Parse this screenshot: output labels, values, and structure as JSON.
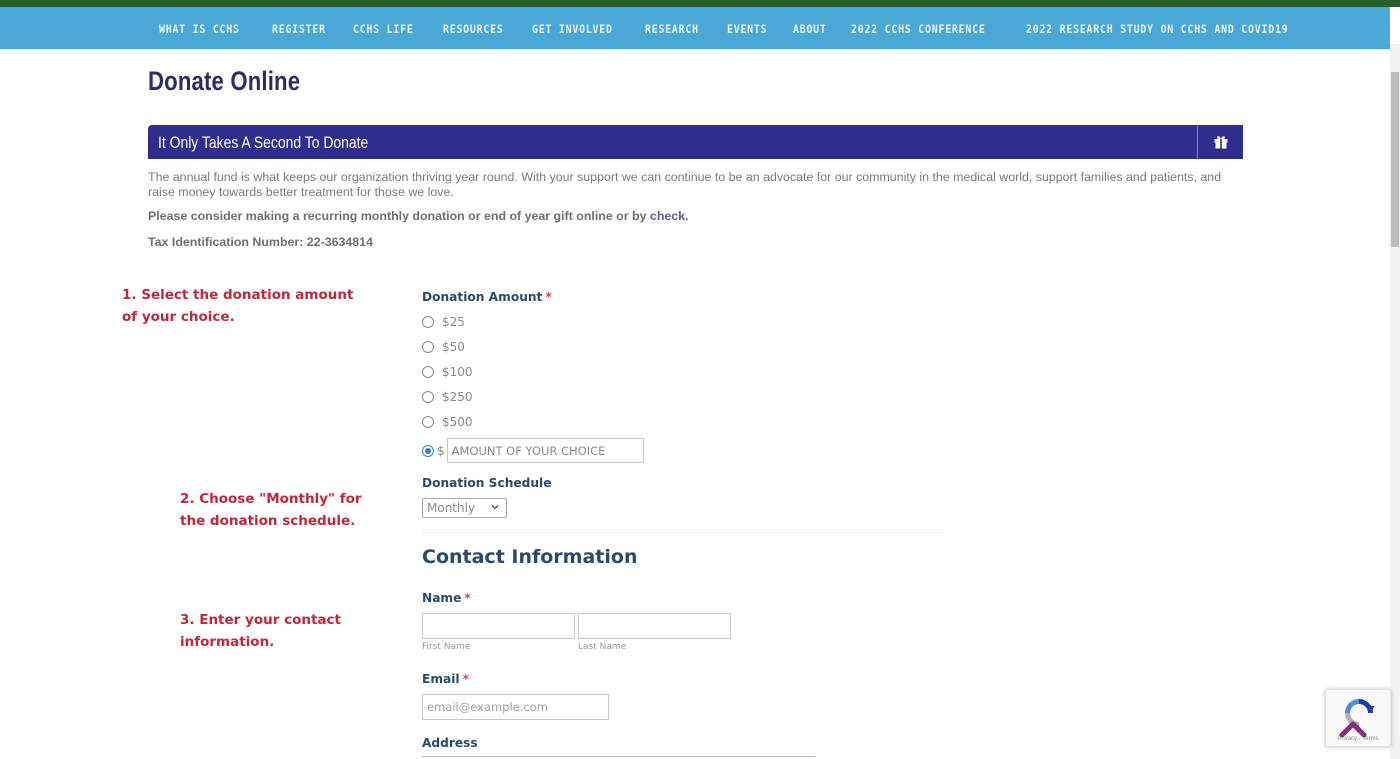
{
  "nav": {
    "items": [
      {
        "label": "WHAT IS CCHS"
      },
      {
        "label": "REGISTER"
      },
      {
        "label": "CCHS LIFE"
      },
      {
        "label": "RESOURCES"
      },
      {
        "label": "GET INVOLVED"
      },
      {
        "label": "RESEARCH"
      },
      {
        "label": "EVENTS"
      },
      {
        "label": "ABOUT"
      },
      {
        "label": "2022 CCHS CONFERENCE"
      },
      {
        "label": "2022 RESEARCH STUDY ON CCHS AND COVID19"
      }
    ]
  },
  "page": {
    "title": "Donate Online",
    "panel_title": "It Only Takes A Second To Donate",
    "panel_icon": "gift-icon",
    "intro": "The annual fund is what keeps our organization thriving year round. With your support we can continue to be an advocate for our community in the medical world, support families and patients, and raise money towards better treatment for those we love.",
    "cta_prefix": "Please consider making a recurring monthly donation or end of year gift online or by ",
    "cta_link": "check.",
    "tax_id": "Tax Identification Number: 22-3634814"
  },
  "steps": {
    "step1": "1. Select the donation amount of your choice.",
    "step2": "2. Choose \"Monthly\" for the donation schedule.",
    "step3": "3. Enter your contact information."
  },
  "form": {
    "donation_amount": {
      "label": "Donation Amount",
      "required_mark": "*",
      "options": [
        "$25",
        "$50",
        "$100",
        "$250",
        "$500"
      ],
      "custom_prefix": "$",
      "custom_placeholder": "AMOUNT OF YOUR CHOICE",
      "custom_value": "",
      "selected": "custom"
    },
    "donation_schedule": {
      "label": "Donation Schedule",
      "selected": "Monthly"
    },
    "contact_section_title": "Contact Information",
    "name": {
      "label": "Name",
      "required_mark": "*",
      "first_value": "",
      "last_value": "",
      "first_sublabel": "First Name",
      "last_sublabel": "Last Name"
    },
    "email": {
      "label": "Email",
      "required_mark": "*",
      "placeholder": "email@example.com",
      "value": ""
    },
    "address": {
      "label": "Address"
    }
  },
  "recaptcha": {
    "text": "Privacy - Terms"
  },
  "colors": {
    "top_strip": "#2a5e2a",
    "nav_bg": "#4aa8d8",
    "panel_bg": "#2e2e8e",
    "title_color": "#2b2d63",
    "step_color": "#c0283a",
    "label_color": "#2c4a68",
    "radio_selected": "#2f7fd6"
  }
}
